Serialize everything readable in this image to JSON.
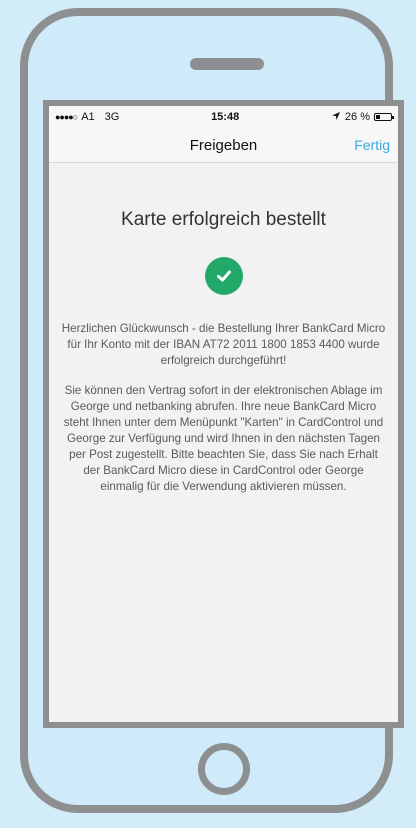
{
  "status_bar": {
    "carrier": "A1",
    "network": "3G",
    "time": "15:48",
    "battery": "26 %",
    "battery_level_percent": 26
  },
  "nav": {
    "title": "Freigeben",
    "done_label": "Fertig"
  },
  "main": {
    "headline": "Karte erfolgreich bestellt",
    "congrats": "Herzlichen Glückwunsch - die Bestellung Ihrer BankCard Micro für Ihr Konto mit der IBAN AT72 2011 1800 1853 4400 wurde erfolgreich durchgeführt!",
    "details": "Sie können den Vertrag sofort in der elektronischen Ablage im George und netbanking abrufen. Ihre neue BankCard Micro steht Ihnen unter dem Menüpunkt \"Karten\" in CardControl und George zur Verfügung und wird Ihnen in den nächsten Tagen per Post zugestellt. Bitte beachten Sie, dass Sie nach Erhalt der BankCard Micro diese in CardControl oder George einmalig für die Verwendung aktivieren müssen."
  },
  "colors": {
    "accent": "#3da7e0",
    "success": "#22a96a",
    "background": "#d3ecfa"
  },
  "icons": [
    "checkmark-icon",
    "signal-icon",
    "location-icon",
    "battery-icon",
    "home-button-icon"
  ]
}
